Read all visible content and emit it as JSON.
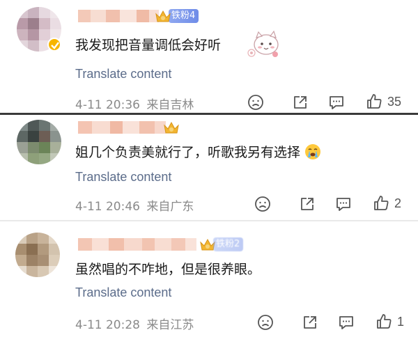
{
  "comments": [
    {
      "fan_badge": "铁粉4",
      "text": "我发现把音量调低会好听",
      "translate": "Translate content",
      "time": "4-11 20:36",
      "location": "来自吉林",
      "likes": "35"
    },
    {
      "fan_badge": "",
      "text": "姐几个负责美就行了，听歌我另有选择",
      "translate": "Translate content",
      "time": "4-11 20:46",
      "location": "来自广东",
      "likes": "2"
    },
    {
      "fan_badge": "铁粉2",
      "text": "虽然唱的不咋地，但是很养眼。",
      "translate": "Translate content",
      "time": "4-11 20:28",
      "location": "来自江苏",
      "likes": "1"
    }
  ],
  "icons": [
    "sad-face-icon",
    "share-icon",
    "comment-icon",
    "thumbs-up-icon",
    "crying-emoji-icon",
    "crown-icon",
    "verified-icon"
  ],
  "colors": {
    "link": "#5b6c8a",
    "meta": "#8a8a8a",
    "badge": "#6f8ce8",
    "crown": "#f2b530"
  }
}
